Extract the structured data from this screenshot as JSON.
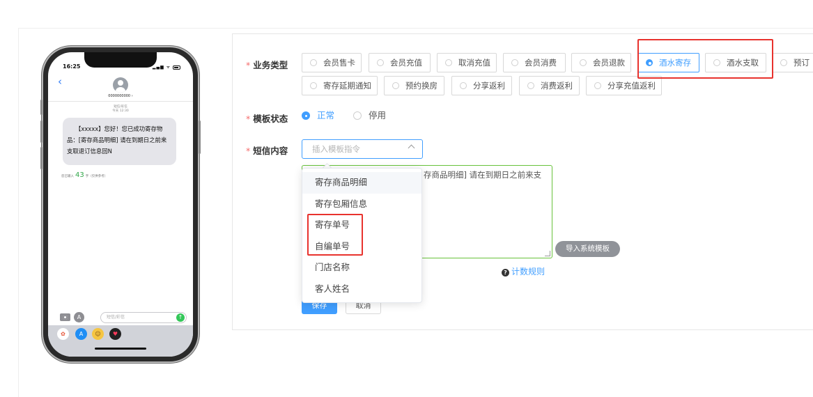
{
  "phone": {
    "time": "16:25",
    "status_icons": "▂▄▆ ᯤ",
    "back_icon": "‹",
    "contact_number": "0000000000 ›",
    "meta_line1": "短信/彩信",
    "meta_line2": "今天 12:30",
    "message": "【xxxxx】您好！您已成功寄存物品：[寄存商品明细] 请在到期日之前来支取退订信息回N",
    "char_count_prefix": "您已输入",
    "char_count": "43",
    "char_count_suffix": "字（仅供参考）",
    "apps_glyph": "A",
    "imessage_placeholder": "短信/彩信",
    "send_glyph": "↑",
    "dock_icons": [
      {
        "name": "photos-icon",
        "glyph": "✿",
        "color": "#ffffff",
        "fg": "#e6573a"
      },
      {
        "name": "appstore-icon",
        "glyph": "A",
        "color": "#1f8ef5",
        "fg": "#ffffff"
      },
      {
        "name": "memoji-icon",
        "glyph": "☺",
        "color": "#f5c542",
        "fg": "#7a4b12"
      },
      {
        "name": "heart-icon",
        "glyph": "♥",
        "color": "#222222",
        "fg": "#ff3b5c"
      }
    ]
  },
  "form": {
    "business_type_label": "业务类型",
    "template_status_label": "模板状态",
    "sms_content_label": "短信内容",
    "business_types": [
      {
        "label": "会员售卡",
        "active": false
      },
      {
        "label": "会员充值",
        "active": false
      },
      {
        "label": "取消充值",
        "active": false
      },
      {
        "label": "会员消费",
        "active": false
      },
      {
        "label": "会员退款",
        "active": false
      },
      {
        "label": "酒水寄存",
        "active": true
      },
      {
        "label": "酒水支取",
        "active": false
      },
      {
        "label": "预订",
        "active": false
      },
      {
        "label": "寄存延期通知",
        "active": false
      },
      {
        "label": "预约换房",
        "active": false
      },
      {
        "label": "分享返利",
        "active": false
      },
      {
        "label": "消费返利",
        "active": false
      },
      {
        "label": "分享充值返利",
        "active": false
      }
    ],
    "status_options": [
      {
        "label": "正常",
        "active": true
      },
      {
        "label": "停用",
        "active": false
      }
    ],
    "select_placeholder": "插入模板指令",
    "textarea_visible_text": "存商品明细] 请在到期日之前来支",
    "import_button": "导入系统模板",
    "count_rule": "计数规则",
    "save_button": "保存",
    "cancel_button": "取消"
  },
  "dropdown": {
    "options": [
      "寄存商品明细",
      "寄存包厢信息",
      "寄存单号",
      "自编单号",
      "门店名称",
      "客人姓名"
    ],
    "hover_index": 0
  },
  "colors": {
    "accent": "#409eff",
    "success_border": "#67c23a",
    "required": "#f56c6c",
    "highlight": "#e8322d"
  }
}
